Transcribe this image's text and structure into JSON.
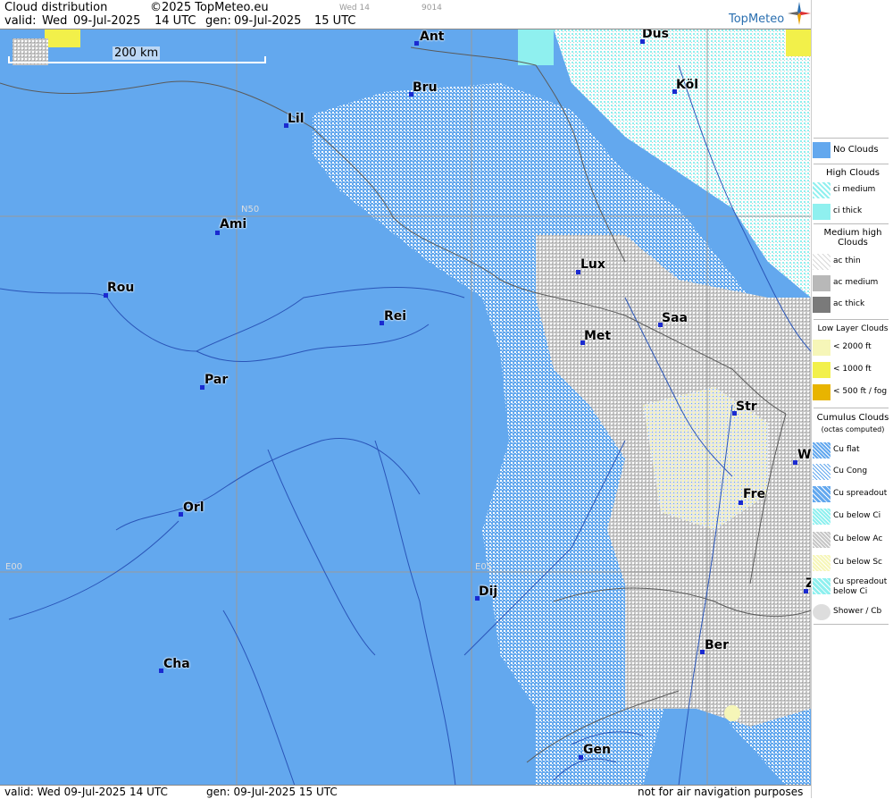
{
  "header": {
    "title": "Cloud distribution",
    "copyright": "©2025 TopMeteo.eu",
    "valid_label": "valid:",
    "valid_day": "Wed",
    "valid_date": "09-Jul-2025",
    "valid_time": "14 UTC",
    "gen_label": "gen:",
    "gen_date": "09-Jul-2025",
    "gen_time": "15 UTC",
    "tab_left": "Wed 14",
    "tab_right": "9014",
    "logo": "TopMeteo"
  },
  "footer": {
    "valid": "valid:  Wed  09-Jul-2025  14 UTC",
    "gen": "gen: 09-Jul-2025 15 UTC",
    "disclaimer": "not for air navigation purposes"
  },
  "map": {
    "scale_label": "200 km",
    "grid_labels": {
      "n50": "N50",
      "e00": "E00",
      "e05": "E05"
    },
    "cities": [
      {
        "label": "Ant"
      },
      {
        "label": "Düs"
      },
      {
        "label": "Köl"
      },
      {
        "label": "Bru"
      },
      {
        "label": "Lil"
      },
      {
        "label": "Ami"
      },
      {
        "label": "Lux"
      },
      {
        "label": "Rou"
      },
      {
        "label": "Rei"
      },
      {
        "label": "Saa"
      },
      {
        "label": "Met"
      },
      {
        "label": "Par"
      },
      {
        "label": "Str"
      },
      {
        "label": "W"
      },
      {
        "label": "Fre"
      },
      {
        "label": "Orl"
      },
      {
        "label": "Dij"
      },
      {
        "label": "Z"
      },
      {
        "label": "Ber"
      },
      {
        "label": "Cha"
      },
      {
        "label": "Gen"
      }
    ]
  },
  "legend": {
    "no_clouds": "No Clouds",
    "high_clouds": "High Clouds",
    "ci_medium": "ci medium",
    "ci_thick": "ci thick",
    "medium_high": "Medium high Clouds",
    "ac_thin": "ac thin",
    "ac_medium": "ac medium",
    "ac_thick": "ac thick",
    "low_layer": "Low Layer Clouds",
    "lt2000": "< 2000 ft",
    "lt1000": "< 1000 ft",
    "lt500": "< 500 ft / fog",
    "cumulus": "Cumulus Clouds",
    "cumulus_sub": "(octas computed)",
    "cu_flat": "Cu flat",
    "cu_cong": "Cu Cong",
    "cu_spreadout": "Cu spreadout",
    "cu_below_ci": "Cu below Ci",
    "cu_below_ac": "Cu below Ac",
    "cu_below_sc": "Cu below Sc",
    "cu_spreadout_below_ci": "Cu spreadout below Ci",
    "shower": "Shower / Cb"
  },
  "colors": {
    "no_clouds": "#63a8ee",
    "ci": "#8ff0ef",
    "ac_medium": "#b8b8b8",
    "ac_thick": "#7a7a7a",
    "low_2000": "#f6f6b8",
    "low_1000": "#f2f04a",
    "fog": "#e8b400",
    "city_dot": "#1a2ad0"
  }
}
